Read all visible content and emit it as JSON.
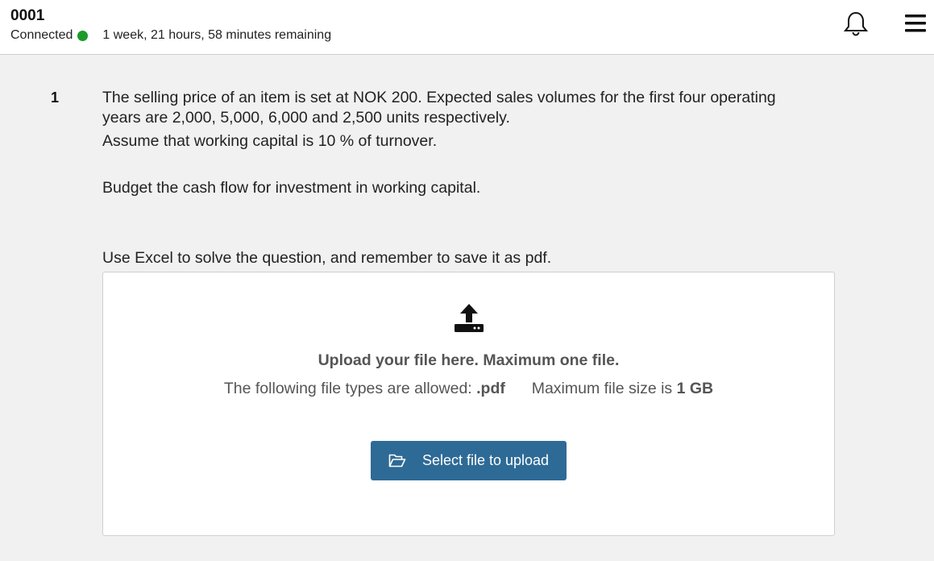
{
  "header": {
    "candidate_id": "0001",
    "connection_label": "Connected",
    "connection_color": "#1a9b2a",
    "time_remaining": "1 week, 21 hours, 58 minutes remaining",
    "icons": [
      "bell-icon",
      "hamburger-menu-icon"
    ]
  },
  "question": {
    "number": "1",
    "paragraphs": [
      "The selling price of an item is set at NOK 200. Expected sales volumes for the first four operating years are 2,000, 5,000, 6,000 and 2,500 units respectively.",
      "Assume that working capital is 10 % of turnover.",
      "Budget the cash flow for investment in working capital.",
      "Use Excel to solve the question, and remember to save it as pdf."
    ]
  },
  "upload": {
    "icon": "upload-icon",
    "title": "Upload your file here. Maximum one file.",
    "allowed_prefix": "The following file types are allowed:",
    "allowed_types": ".pdf",
    "max_size_prefix": "Maximum file size is",
    "max_size": "1 GB",
    "button_label": "Select file to upload",
    "button_icon": "folder-open-icon",
    "button_color": "#2e6a96"
  }
}
